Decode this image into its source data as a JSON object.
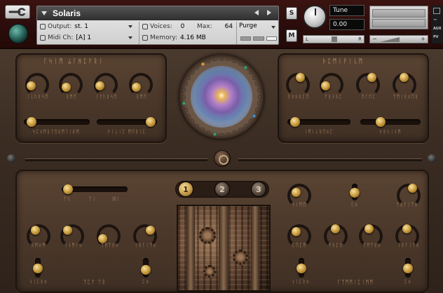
{
  "header": {
    "instrument_name": "Solaris",
    "output_label": "Output:",
    "output_value": "st. 1",
    "midi_label": "Midi Ch:",
    "midi_value": "[A] 1",
    "voices_label": "Voices:",
    "voices_value": "0",
    "max_label": "Max:",
    "max_value": "64",
    "memory_label": "Memory:",
    "memory_value": "4.16 MB",
    "purge_label": "Purge",
    "solo_label": "S",
    "mute_label": "M",
    "tune_label": "Tune",
    "tune_value": "0.00",
    "pan_left": "L",
    "pan_right": "R",
    "vol_minus": "−",
    "vol_plus": "+",
    "side_tab_aux": "AUX",
    "side_tab_pv": "PV"
  },
  "top_left_panel": {
    "title": "ᚴᛋᛁᛗ ᛦᚴᚻᛈᚹᚱᛁ",
    "knob_labels": [
      "ᛁᚳᚢᚱᛋᛖ",
      "ᚱᛗᛖ",
      "ᛁᚹᚢᚱᛋᛖ",
      "ᚱᛗᛖ"
    ],
    "slider_labels": [
      "ᛋᛈᛟᛗᚱᛏᛖᚱᛗᛏᛁᛒᛗ",
      "ᚹᛁᚳᛁᛈ ᛗᛖᚱᛁᛈ"
    ]
  },
  "top_right_panel": {
    "title": "ᚦᛈᛗᛁᚹᛁᚳᛗ",
    "knob_labels": [
      "ᚱᛟᛟᚱᛈᛖ",
      "ᚠᚱᚾᚱᛈ",
      "ᛖᚴᛖᛈ",
      "ᛉᛗᛁᚱᛟᛖᚱ"
    ],
    "slider_labels": [
      "ᛁᛗᛁᚳᚱᛖᛟᛈ",
      "ᚦᚱᚾᛁᚾᛗ"
    ]
  },
  "bottom_panel": {
    "slider_ticks": [
      "ᛏᚢ",
      "ᛏᛁ",
      "ᛞᛁ"
    ],
    "right_labels": [
      "ᚾᛁᛗᛖ",
      "ᛈᛟ",
      "ᛉᚱᚴᛁᛉᛟ"
    ],
    "left_knob_labels": [
      "ᚷᛗᛟᛗ",
      "ᛁᚾᛗᛁᛟ",
      "ᛉᛗᛉᚱᛟ",
      "ᛉᚱᚴᛁᛉᛟ"
    ],
    "right_knob_labels": [
      "ᛈᛖᛈᛗ",
      "ᚠᚱᛈᚢ",
      "ᛉᛗᛉᚱᛟ",
      "ᛉᚱᚴᛁᛉᛟ"
    ],
    "bottom_left_labels": [
      "ᚾᛁᛈᚱᛟ",
      "ᛉᛈᚠ ᛏᚱ",
      "ᛈᛟ"
    ],
    "bottom_right_labels": [
      "ᚾᛁᛈᚱᛟ",
      "ᚴᛉᛗᛗᛁᛈᛁᛗᛗ",
      "ᛈᛟ"
    ],
    "num_buttons": [
      "1",
      "2",
      "3"
    ]
  },
  "colors": {
    "accent_gold": "#c99a3c",
    "panel_brown": "#4b382a",
    "header_red": "#2a0c0a",
    "glyph": "#b8926c"
  }
}
